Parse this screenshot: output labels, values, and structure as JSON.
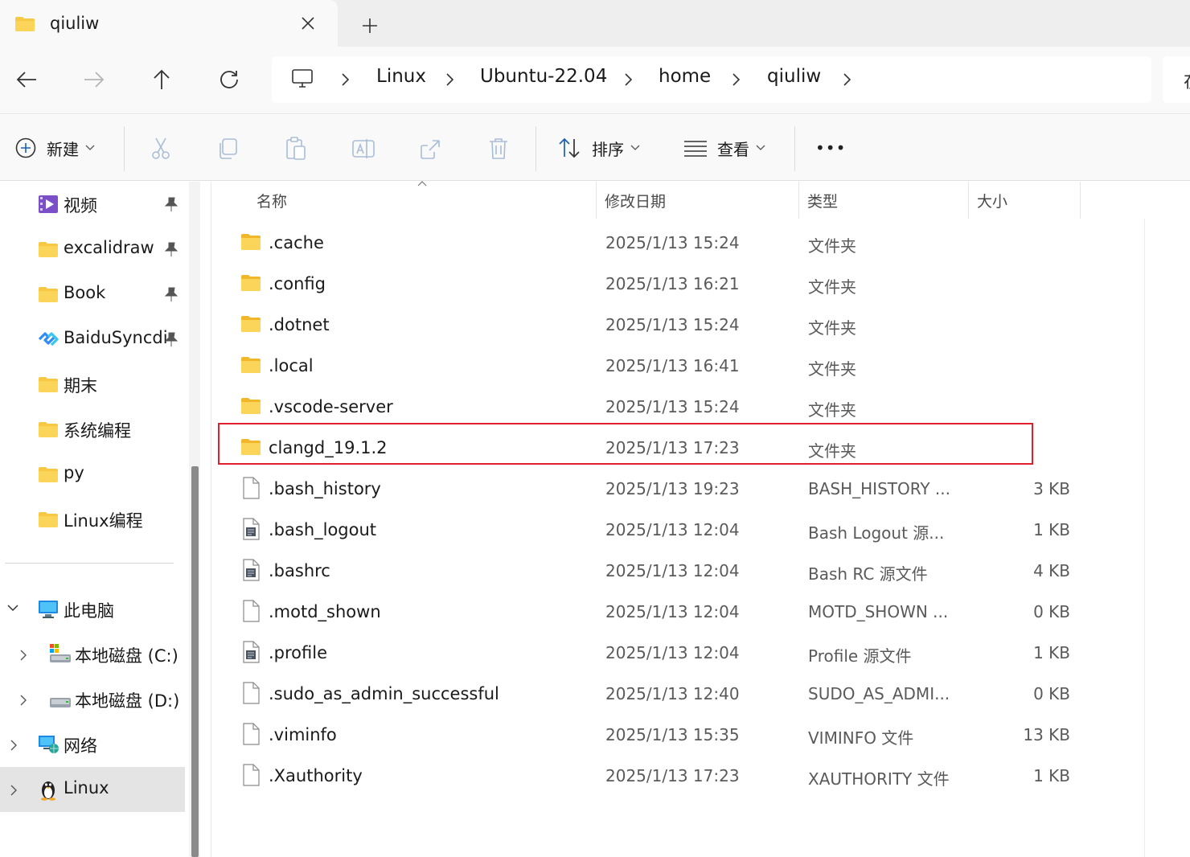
{
  "tab": {
    "title": "qiuliw"
  },
  "breadcrumb": [
    "Linux",
    "Ubuntu-22.04",
    "home",
    "qiuliw"
  ],
  "search_placeholder_glyph": "在",
  "toolbar": {
    "new_label": "新建",
    "sort_label": "排序",
    "view_label": "查看",
    "more_label": "•••"
  },
  "sidebar": {
    "quick": [
      {
        "label": "视频",
        "icon": "video-folder",
        "pinned": true
      },
      {
        "label": "excalidraw",
        "icon": "folder",
        "pinned": true
      },
      {
        "label": "Book",
        "icon": "folder",
        "pinned": true
      },
      {
        "label": "BaiduSyncdi",
        "icon": "baidu-sync",
        "pinned": true
      },
      {
        "label": "期末",
        "icon": "folder",
        "pinned": false
      },
      {
        "label": "系统编程",
        "icon": "folder",
        "pinned": false
      },
      {
        "label": "py",
        "icon": "folder",
        "pinned": false
      },
      {
        "label": "Linux编程",
        "icon": "folder",
        "pinned": false
      }
    ],
    "tree": [
      {
        "label": "此电脑",
        "expanded": true
      },
      {
        "label": "本地磁盘 (C:)",
        "expanded": false
      },
      {
        "label": "本地磁盘 (D:)",
        "expanded": false
      },
      {
        "label": "网络",
        "expanded": false
      },
      {
        "label": "Linux",
        "expanded": false,
        "selected": true
      }
    ]
  },
  "columns": {
    "name": "名称",
    "date": "修改日期",
    "type": "类型",
    "size": "大小"
  },
  "files": [
    {
      "name": ".cache",
      "date": "2025/1/13 15:24",
      "type": "文件夹",
      "size": "",
      "kind": "folder"
    },
    {
      "name": ".config",
      "date": "2025/1/13 16:21",
      "type": "文件夹",
      "size": "",
      "kind": "folder"
    },
    {
      "name": ".dotnet",
      "date": "2025/1/13 15:24",
      "type": "文件夹",
      "size": "",
      "kind": "folder"
    },
    {
      "name": ".local",
      "date": "2025/1/13 16:41",
      "type": "文件夹",
      "size": "",
      "kind": "folder"
    },
    {
      "name": ".vscode-server",
      "date": "2025/1/13 15:24",
      "type": "文件夹",
      "size": "",
      "kind": "folder"
    },
    {
      "name": "clangd_19.1.2",
      "date": "2025/1/13 17:23",
      "type": "文件夹",
      "size": "",
      "kind": "folder",
      "highlighted": true
    },
    {
      "name": ".bash_history",
      "date": "2025/1/13 19:23",
      "type": "BASH_HISTORY ...",
      "size": "3 KB",
      "kind": "file"
    },
    {
      "name": ".bash_logout",
      "date": "2025/1/13 12:04",
      "type": "Bash Logout 源...",
      "size": "1 KB",
      "kind": "script"
    },
    {
      "name": ".bashrc",
      "date": "2025/1/13 12:04",
      "type": "Bash RC 源文件",
      "size": "4 KB",
      "kind": "script"
    },
    {
      "name": ".motd_shown",
      "date": "2025/1/13 12:04",
      "type": "MOTD_SHOWN ...",
      "size": "0 KB",
      "kind": "file"
    },
    {
      "name": ".profile",
      "date": "2025/1/13 12:04",
      "type": "Profile 源文件",
      "size": "1 KB",
      "kind": "script"
    },
    {
      "name": ".sudo_as_admin_successful",
      "date": "2025/1/13 12:40",
      "type": "SUDO_AS_ADMI...",
      "size": "0 KB",
      "kind": "file"
    },
    {
      "name": ".viminfo",
      "date": "2025/1/13 15:35",
      "type": "VIMINFO 文件",
      "size": "13 KB",
      "kind": "file"
    },
    {
      "name": ".Xauthority",
      "date": "2025/1/13 17:23",
      "type": "XAUTHORITY 文件",
      "size": "1 KB",
      "kind": "file"
    }
  ],
  "colors": {
    "folder": "#f7c843",
    "folder_dark": "#e6a817",
    "highlight": "#e0202c",
    "selected_bg": "#e4e4e4"
  }
}
